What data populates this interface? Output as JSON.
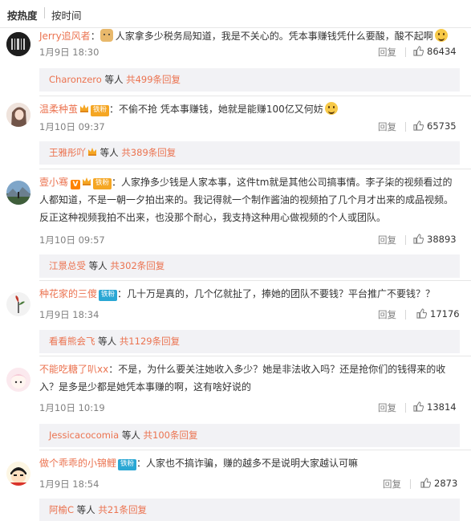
{
  "sort": {
    "by_hot": "按热度",
    "by_time": "按时间"
  },
  "ui": {
    "reply_label": "回复",
    "like_icon": "thumbs-up-icon",
    "link_color": "#eb7350",
    "reply_bg": "#f2f2f5"
  },
  "comments": [
    {
      "user": "Jerry追风者",
      "separator": "：",
      "text": "人家拿多少税务局知道，我是不关心的。凭本事赚钱凭什么要酸，酸不起啊",
      "time": "1月9日 18:30",
      "likes": "86434",
      "reply_user": "Charonzero",
      "reply_mid": " 等人 ",
      "reply_count": "共499条回复"
    },
    {
      "user": "温柔种茧",
      "badge": "铁粉",
      "separator": "：",
      "text": "不偷不抢 凭本事赚钱，她就是能赚100亿又何妨",
      "time": "1月10日 09:37",
      "likes": "65735",
      "reply_user": "王雅彤吖",
      "reply_mid": " 等人 ",
      "reply_count": "共389条回复"
    },
    {
      "user": "壹小骞",
      "vip": "V",
      "badge": "铁粉",
      "separator": "：",
      "text": "人家挣多少钱是人家本事，这件tm就是其他公司搞事情。李子柒的视频看过的人都知道，不是一朝一夕拍出来的。我记得就一个制作酱油的视频拍了几个月才出来的成品视频。反正这种视频我拍不出来，也没那个耐心，我支持这种用心做视频的个人或团队。",
      "time": "1月10日 09:57",
      "likes": "38893",
      "reply_user": "江景总受",
      "reply_mid": " 等人 ",
      "reply_count": "共302条回复"
    },
    {
      "user": "种花家的三傻",
      "badge": "铁粉",
      "separator": "：",
      "text": "几十万是真的，几个亿就扯了，捧她的团队不要钱？平台推广不要钱？？",
      "time": "1月9日 18:34",
      "likes": "17176",
      "reply_user": "看看熊会飞",
      "reply_mid": " 等人 ",
      "reply_count": "共1129条回复"
    },
    {
      "user": "不能吃糖了叭xx",
      "separator": "：",
      "text": "不是，为什么要关注她收入多少？她是非法收入吗？还是抢你们的钱得来的收入？是多是少都是她凭本事赚的啊，这有啥好说的",
      "time": "1月10日 10:19",
      "likes": "13814",
      "reply_user": "Jessicacocomia",
      "reply_mid": " 等人 ",
      "reply_count": "共100条回复"
    },
    {
      "user": "做个乖乖的小锦鲤",
      "badge": "铁粉",
      "separator": "：",
      "text": "人家也不搞诈骗，赚的越多不是说明大家越认可嘛",
      "time": "1月9日 18:54",
      "likes": "2873",
      "reply_user": "阿榆C",
      "reply_mid": " 等人 ",
      "reply_count": "共21条回复"
    }
  ]
}
